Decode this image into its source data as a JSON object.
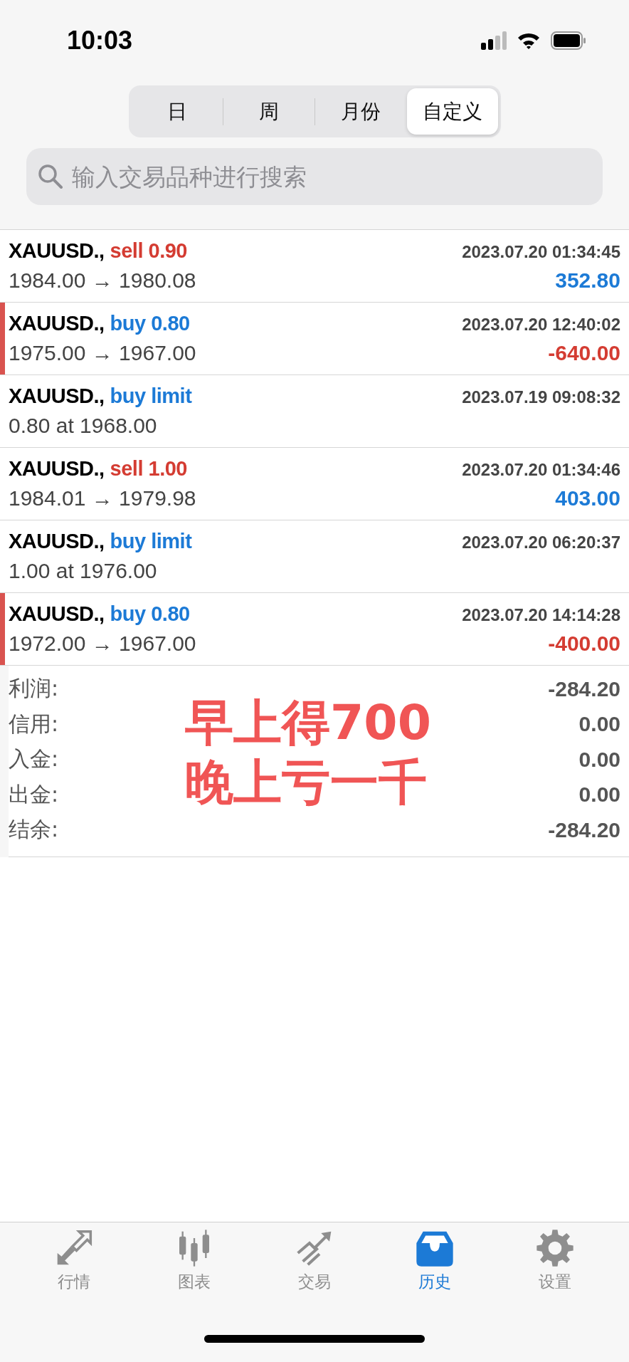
{
  "status_bar": {
    "time": "10:03"
  },
  "period_tabs": [
    {
      "label": "日",
      "selected": false
    },
    {
      "label": "周",
      "selected": false
    },
    {
      "label": "月份",
      "selected": false
    },
    {
      "label": "自定义",
      "selected": true
    }
  ],
  "search": {
    "placeholder": "输入交易品种进行搜索"
  },
  "history": [
    {
      "symbol": "XAUUSD.,",
      "order": "sell 0.90",
      "sell": true,
      "time": "2023.07.20 01:34:45",
      "detail": "1984.00 → 1980.08",
      "profit": "352.80",
      "negative": false,
      "flagged": false
    },
    {
      "symbol": "XAUUSD.,",
      "order": "buy 0.80",
      "sell": false,
      "time": "2023.07.20 12:40:02",
      "detail": "1975.00 → 1967.00",
      "profit": "-640.00",
      "negative": true,
      "flagged": true
    },
    {
      "symbol": "XAUUSD.,",
      "order": "buy limit",
      "sell": false,
      "time": "2023.07.19 09:08:32",
      "detail": "0.80 at 1968.00",
      "flagged": false
    },
    {
      "symbol": "XAUUSD.,",
      "order": "sell 1.00",
      "sell": true,
      "time": "2023.07.20 01:34:46",
      "detail": "1984.01 → 1979.98",
      "profit": "403.00",
      "negative": false,
      "flagged": false
    },
    {
      "symbol": "XAUUSD.,",
      "order": "buy limit",
      "sell": false,
      "time": "2023.07.20 06:20:37",
      "detail": "1.00 at 1976.00",
      "flagged": false
    },
    {
      "symbol": "XAUUSD.,",
      "order": "buy 0.80",
      "sell": false,
      "time": "2023.07.20 14:14:28",
      "detail": "1972.00 → 1967.00",
      "profit": "-400.00",
      "negative": true,
      "flagged": true
    }
  ],
  "summary": [
    {
      "label": "利润:",
      "value": "-284.20"
    },
    {
      "label": "信用:",
      "value": "0.00"
    },
    {
      "label": "入金:",
      "value": "0.00"
    },
    {
      "label": "出金:",
      "value": "0.00"
    },
    {
      "label": "结余:",
      "value": "-284.20"
    }
  ],
  "annotation": [
    "早上得700",
    "晚上亏一千"
  ],
  "tab_bar": [
    {
      "kind": "quotes",
      "label": "行情",
      "selected": false
    },
    {
      "kind": "chart",
      "label": "图表",
      "selected": false
    },
    {
      "kind": "trade",
      "label": "交易",
      "selected": false
    },
    {
      "kind": "history",
      "label": "历史",
      "selected": true
    },
    {
      "kind": "settings",
      "label": "设置",
      "selected": false
    }
  ]
}
